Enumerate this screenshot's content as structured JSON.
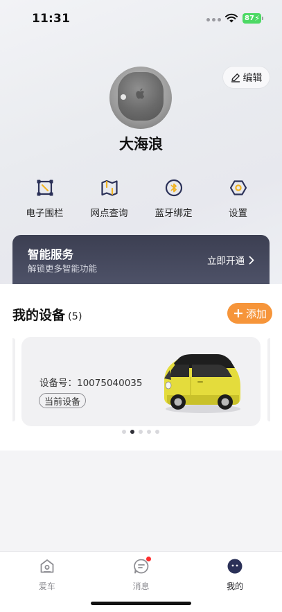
{
  "status_bar": {
    "time": "11:31",
    "battery": "87"
  },
  "profile": {
    "edit_label": "编辑",
    "username": "大海浪"
  },
  "actions": [
    {
      "label": "电子围栏",
      "icon": "fence-icon"
    },
    {
      "label": "网点查询",
      "icon": "map-icon"
    },
    {
      "label": "蓝牙绑定",
      "icon": "bluetooth-icon"
    },
    {
      "label": "设置",
      "icon": "settings-icon"
    }
  ],
  "service": {
    "title": "智能服务",
    "subtitle": "解锁更多智能功能",
    "cta": "立即开通"
  },
  "devices": {
    "title": "我的设备",
    "count": "(5)",
    "add_label": "添加",
    "card": {
      "device_id": "设备号：10075040035",
      "tag": "当前设备"
    },
    "pager": {
      "total": 5,
      "active_index": 1
    }
  },
  "tabbar": {
    "tabs": [
      {
        "label": "爱车"
      },
      {
        "label": "消息"
      },
      {
        "label": "我的"
      }
    ]
  },
  "colors": {
    "accent_orange": "#f6953a",
    "service_bg": "#3c3f52",
    "icon_navy": "#2b3158",
    "icon_gold": "#f0b323"
  }
}
